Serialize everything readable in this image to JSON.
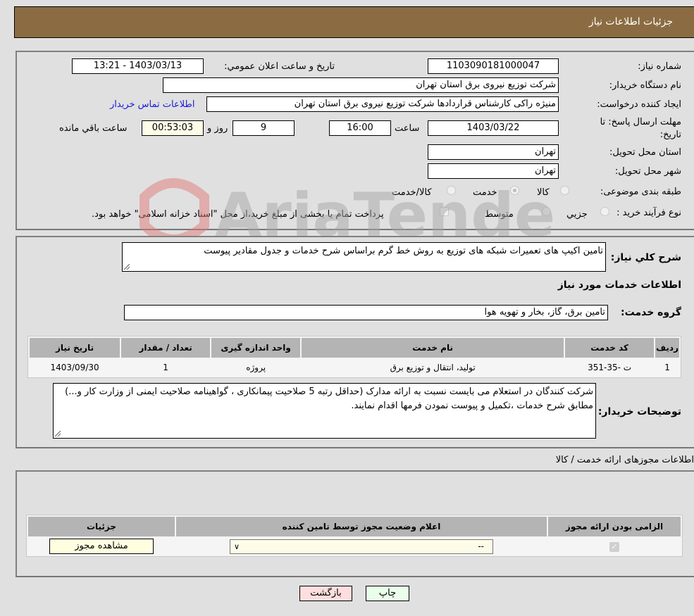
{
  "header": {
    "title": "جزئیات اطلاعات نیاز"
  },
  "form": {
    "need_number_label": "شماره نیاز:",
    "need_number": "1103090181000047",
    "announce_label": "تاریخ و ساعت اعلان عمومي:",
    "announce_value": "1403/03/13 - 13:21",
    "buyer_org_label": "نام دستگاه خريدار:",
    "buyer_org": "شرکت توزیع نیروی برق استان تهران",
    "creator_label": "ایجاد کننده درخواست:",
    "creator": "منیژه راکی کارشناس قراردادها شرکت توزیع نیروی برق استان تهران",
    "contact_link": "اطلاعات تماس خریدار",
    "deadline_label_1": "مهلت ارسال پاسخ: تا",
    "deadline_label_2": "تاریخ:",
    "deadline_date": "1403/03/22",
    "time_label": "ساعت",
    "deadline_time": "16:00",
    "days_value": "9",
    "days_label": "روز و",
    "remaining_time": "00:53:03",
    "remaining_label": "ساعت باقي مانده",
    "province_label": "استان محل تحویل:",
    "province": "تهران",
    "city_label": "شهر محل تحویل:",
    "city": "تهران",
    "category_label": "طبقه بندی موضوعی:",
    "category_options": [
      {
        "label": "کالا",
        "checked": false
      },
      {
        "label": "خدمت",
        "checked": true
      },
      {
        "label": "کالا/خدمت",
        "checked": false
      }
    ],
    "process_label": "نوع فرآیند خرید :",
    "process_options": [
      {
        "label": "جزيي",
        "checked": false
      },
      {
        "label": "متوسط",
        "checked": false
      }
    ],
    "process_note": "پرداخت تمام یا بخشی از مبلغ خرید،از محل \"اسناد خزانه اسلامی\" خواهد بود."
  },
  "details": {
    "summary_label": "شرح کلي نياز:",
    "summary": "تامین اکیپ های تعمیرات شبکه های توزیع به روش خط گرم براساس شرح خدمات و جدول مقادیر پیوست",
    "services_heading": "اطلاعات خدمات مورد نیاز",
    "service_group_label": "گروه خدمت:",
    "service_group": "تامین برق، گاز، بخار و تهویه هوا",
    "table": {
      "headers": [
        "ردیف",
        "کد خدمت",
        "نام خدمت",
        "واحد اندازه گیری",
        "تعداد / مقدار",
        "تاریخ نیاز"
      ],
      "rows": [
        [
          "1",
          "ت -35-351",
          "تولید، انتقال و توزیع برق",
          "پروژه",
          "1",
          "1403/09/30"
        ]
      ]
    },
    "buyer_notes_label": "توضیحات خریدار:",
    "buyer_notes": "شرکت کنندگان در استعلام می بایست نسبت به ارائه مدارک (حداقل رتبه 5 صلاحیت پیمانکاری ، گواهینامه صلاحیت ایمنی از وزارت کار و...) مطابق شرح خدمات ،تکمیل و پیوست نمودن فرمها اقدام نمایند."
  },
  "permits": {
    "title": "اطلاعات مجوزهای ارائه خدمت / کالا",
    "headers": [
      "الزامی بودن ارائه مجوز",
      "اعلام وضعیت مجوز توسط تامین کننده",
      "جزئیات"
    ],
    "row": {
      "required_checked": true,
      "status_select": "--",
      "view_button": "مشاهده مجوز"
    }
  },
  "buttons": {
    "print": "چاپ",
    "back": "بازگشت"
  },
  "watermark": "AriaTender.neT"
}
